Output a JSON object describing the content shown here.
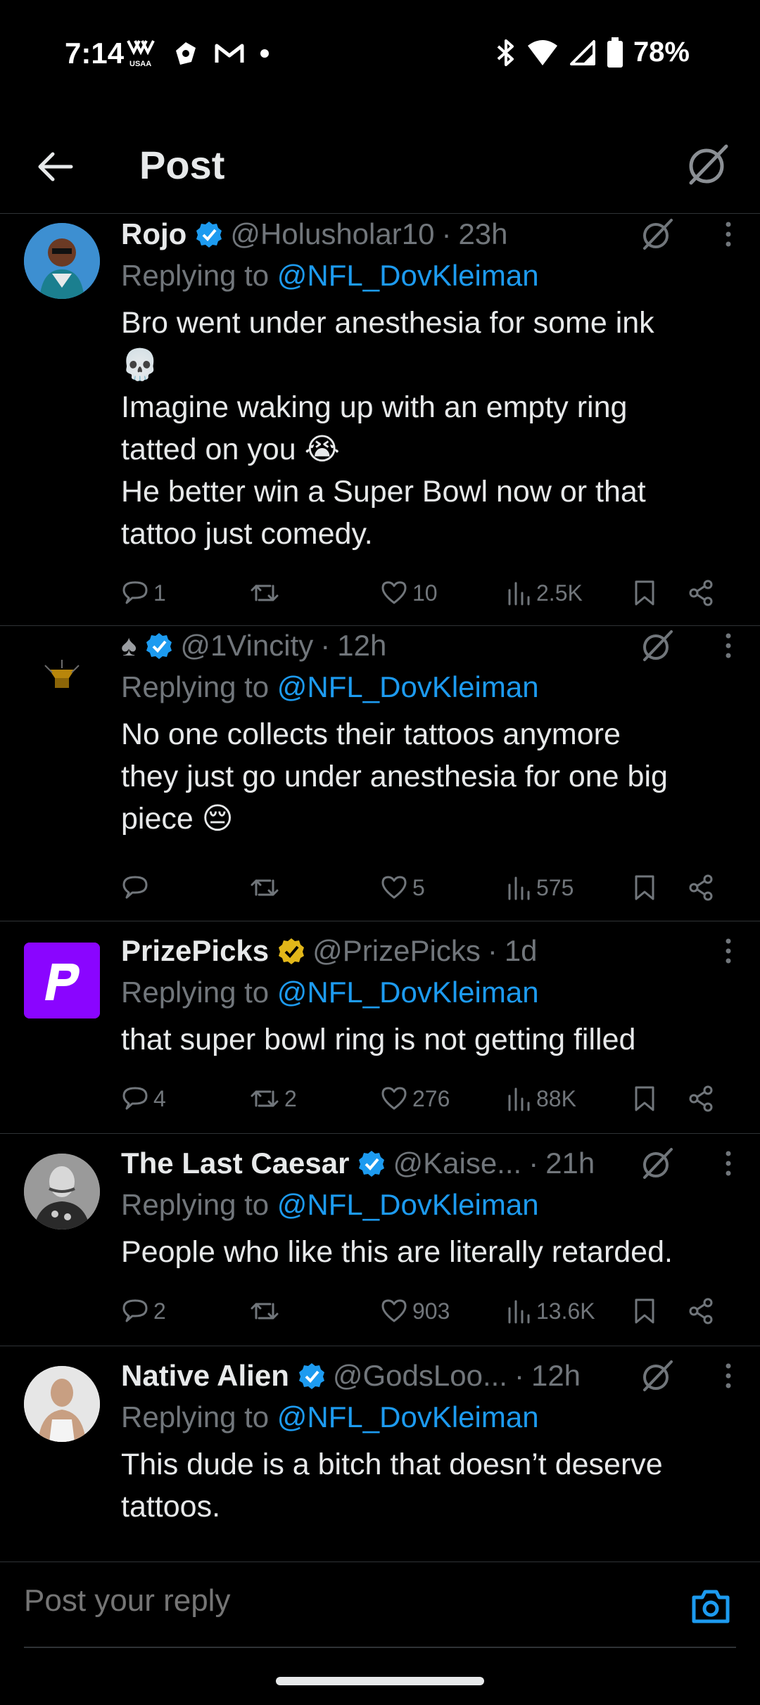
{
  "status_bar": {
    "time": "7:14",
    "battery": "78%",
    "left_icons": [
      "usaa-icon",
      "shield-icon",
      "gmail-icon",
      "dot-icon"
    ],
    "right_icons": [
      "bluetooth-icon",
      "wifi-icon",
      "signal-icon",
      "battery-icon"
    ]
  },
  "header": {
    "title": "Post"
  },
  "replies": [
    {
      "display_name": "Rojo",
      "handle": "@Holusholar10",
      "time": "23h",
      "replying_prefix": "Replying to ",
      "replying_to": "@NFL_DovKleiman",
      "text": "Bro went under anesthesia for some ink\n💀\nImagine waking up with an empty ring\ntatted on you 😭\nHe better win a Super Bowl now or that\ntattoo just comedy.",
      "comments": "1",
      "reposts": "",
      "likes": "10",
      "views": "2.5K",
      "badge_color": "#1d9bf0"
    },
    {
      "display_name": "♠",
      "handle": "@1Vincity",
      "time": "12h",
      "replying_prefix": "Replying to ",
      "replying_to": "@NFL_DovKleiman",
      "text": "No one collects their tattoos anymore\nthey just go under anesthesia for one big\npiece 😔",
      "comments": "",
      "reposts": "",
      "likes": "5",
      "views": "575",
      "badge_color": "#1d9bf0"
    },
    {
      "display_name": "PrizePicks",
      "handle": "@PrizePicks",
      "time": "1d",
      "replying_prefix": "Replying to ",
      "replying_to": "@NFL_DovKleiman",
      "text": "that super bowl ring is not getting filled",
      "comments": "4",
      "reposts": "2",
      "likes": "276",
      "views": "88K",
      "badge_color": "#e2b719"
    },
    {
      "display_name": "The Last Caesar",
      "handle": "@Kaise...",
      "time": "21h",
      "replying_prefix": "Replying to ",
      "replying_to": "@NFL_DovKleiman",
      "text": "People who like this are literally retarded.",
      "comments": "2",
      "reposts": "",
      "likes": "903",
      "views": "13.6K",
      "badge_color": "#1d9bf0"
    },
    {
      "display_name": "Native Alien",
      "handle": "@GodsLoo...",
      "time": "12h",
      "replying_prefix": "Replying to ",
      "replying_to": "@NFL_DovKleiman",
      "text": "This dude is a bitch that doesn’t deserve\ntattoos.",
      "badge_color": "#1d9bf0"
    }
  ],
  "composer": {
    "placeholder": "Post your reply"
  },
  "colors": {
    "background": "#000000",
    "accent": "#1d9bf0",
    "muted": "#71767b",
    "text": "#e7e9ea",
    "divider": "#2f3336"
  }
}
